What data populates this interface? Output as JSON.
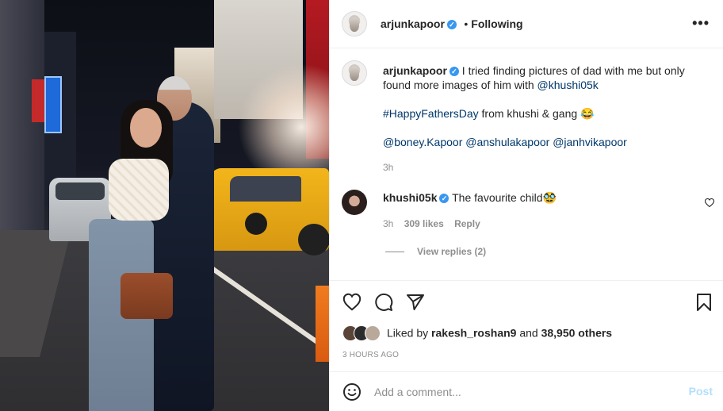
{
  "header": {
    "username": "arjunkapoor",
    "verified_mark": "✓",
    "separator": "•",
    "follow_state": "Following",
    "more_label": "•••"
  },
  "caption": {
    "username": "arjunkapoor",
    "line1": "I tried finding pictures of dad with me but only found more images of him with ",
    "mention1": "@khushi05k",
    "hashtag": "#HappyFathersDay",
    "line2": " from khushi & gang 😂",
    "mention2": "@boney.Kapoor",
    "mention3": "@anshulakapoor",
    "mention4": "@janhvikapoor",
    "time": "3h"
  },
  "comment": {
    "username": "khushi05k",
    "text": "The favourite child🥸",
    "time": "3h",
    "likes": "309 likes",
    "reply_label": "Reply",
    "view_replies": "View replies (2)"
  },
  "actions": {
    "like_icon": "heart-icon",
    "comment_icon": "comment-icon",
    "share_icon": "paper-plane-icon",
    "save_icon": "bookmark-icon"
  },
  "likes": {
    "prefix": "Liked by ",
    "user": "rakesh_roshan9",
    "middle": " and ",
    "others": "38,950 others"
  },
  "time_ago": "3 HOURS AGO",
  "add_comment": {
    "emoji_icon": "smiley-icon",
    "placeholder": "Add a comment...",
    "post_label": "Post"
  },
  "colors": {
    "link": "#00376b",
    "verified": "#3897f0",
    "muted": "#8e8e8e",
    "post_disabled": "#b2dffc"
  }
}
